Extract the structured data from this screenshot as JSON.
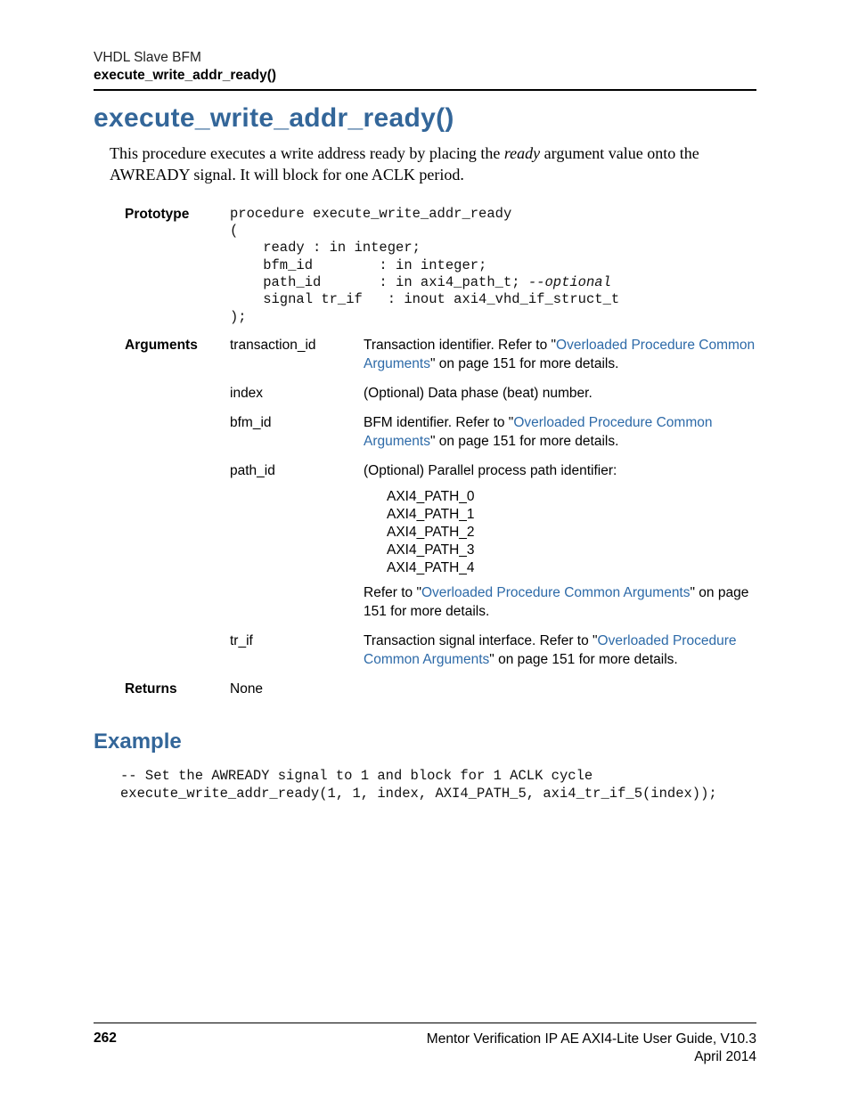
{
  "header": {
    "chapter": "VHDL Slave BFM",
    "func": "execute_write_addr_ready()"
  },
  "title": "execute_write_addr_ready()",
  "intro": {
    "pre": "This procedure executes a write address ready by placing the ",
    "ital": "ready",
    "post": " argument value onto the AWREADY signal. It will block for one ACLK period."
  },
  "sections": {
    "prototype_label": "Prototype",
    "arguments_label": "Arguments",
    "returns_label": "Returns"
  },
  "prototype_code": "procedure execute_write_addr_ready\n(\n    ready : in integer;\n    bfm_id        : in integer;\n    path_id       : in axi4_path_t; ",
  "prototype_code_ital": "--optional",
  "prototype_code2": "\n    signal tr_if   : inout axi4_vhd_if_struct_t\n);",
  "args": {
    "transaction_id": {
      "name": "transaction_id",
      "desc_pre": "Transaction identifier. Refer to \"",
      "link": "Overloaded Procedure Common Arguments",
      "desc_post": "\" on page 151 for more details."
    },
    "index": {
      "name": "index",
      "desc": "(Optional) Data phase (beat) number."
    },
    "bfm_id": {
      "name": "bfm_id",
      "desc_pre": "BFM identifier. Refer to \"",
      "link": "Overloaded Procedure Common Arguments",
      "desc_post": "\" on page 151 for more details."
    },
    "path_id": {
      "name": "path_id",
      "desc_intro": "(Optional) Parallel process path identifier:",
      "items": [
        "AXI4_PATH_0",
        "AXI4_PATH_1",
        "AXI4_PATH_2",
        "AXI4_PATH_3",
        "AXI4_PATH_4"
      ],
      "desc_after_pre": "Refer to \"",
      "desc_after_link": "Overloaded Procedure Common Arguments",
      "desc_after_post": "\" on page 151 for more details."
    },
    "tr_if": {
      "name": "tr_if",
      "desc_pre": "Transaction signal interface. Refer to \"",
      "link": "Overloaded Procedure Common Arguments",
      "desc_post": "\" on page 151 for more details."
    }
  },
  "returns_value": "None",
  "example_heading": "Example",
  "example_code": "-- Set the AWREADY signal to 1 and block for 1 ACLK cycle\nexecute_write_addr_ready(1, 1, index, AXI4_PATH_5, axi4_tr_if_5(index));",
  "footer": {
    "page": "262",
    "doc": "Mentor Verification IP AE AXI4-Lite User Guide, V10.3",
    "date": "April 2014"
  }
}
